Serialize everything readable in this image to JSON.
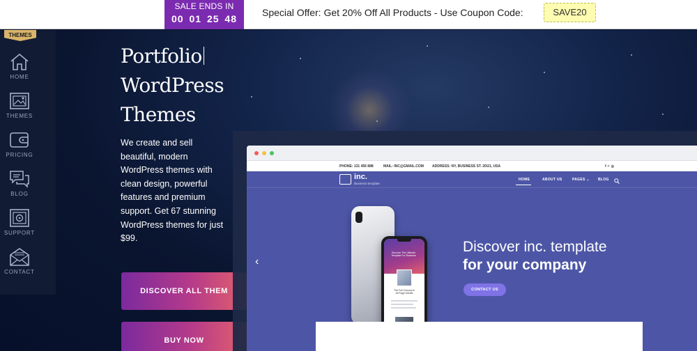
{
  "promo": {
    "sale_label": "SALE ENDS IN",
    "timer": "00 01 25 48",
    "offer_text": "Special Offer:  Get 20% Off All Products - Use Coupon Code:",
    "coupon_code": "SAVE20",
    "colors": {
      "sale_bg": "#7b2bb0",
      "coupon_bg": "#fdfcb0"
    }
  },
  "sidebar": {
    "badge": "THEMES",
    "items": [
      {
        "label": "HOME",
        "icon": "home-icon"
      },
      {
        "label": "THEMES",
        "icon": "image-icon"
      },
      {
        "label": "PRICING",
        "icon": "wallet-icon"
      },
      {
        "label": "BLOG",
        "icon": "chat-icon"
      },
      {
        "label": "SUPPORT",
        "icon": "safe-icon"
      },
      {
        "label": "CONTACT",
        "icon": "envelope-icon"
      }
    ]
  },
  "hero": {
    "title_lines": [
      "Portfolio",
      "WordPress",
      "Themes"
    ],
    "description": "We create and sell beautiful, modern WordPress themes with clean design, powerful features and premium support. Get 67 stunning WordPress themes for just $99.",
    "discover_button": "DISCOVER ALL THEM",
    "buy_button": "BUY NOW",
    "button_gradient": [
      "#7b2a9e",
      "#e2606c"
    ]
  },
  "preview": {
    "phone": "PHONE: 131 456 888",
    "mail": "MAIL: INC@GMAIL.COM",
    "address": "ADDRESS: NY, BUSINESS ST. 20/21, USA",
    "social": "f ✓ ◎",
    "brand": "inc.",
    "brand_sub": "Business template",
    "nav": [
      "HOME",
      "ABOUT US",
      "PAGES ⌄",
      "BLOG"
    ],
    "headline_1": "Discover inc. template",
    "headline_2": "for your company",
    "contact_button": "CONTACT US",
    "phone_screen_title": "Discover The Ultimate Template For Business",
    "phone_screen_caption": "The Full Concept & All Page Details",
    "site_color": "#4d56a6"
  }
}
